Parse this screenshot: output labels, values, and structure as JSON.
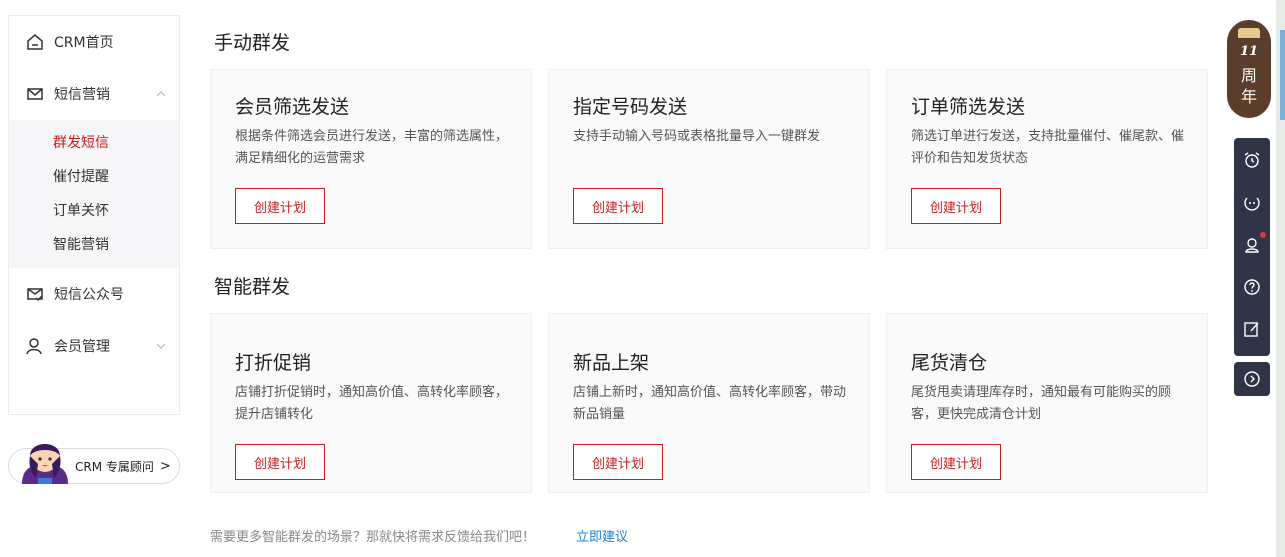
{
  "sidebar": {
    "home": "CRM首页",
    "sms_marketing": "短信营销",
    "sub_items": [
      "群发短信",
      "催付提醒",
      "订单关怀",
      "智能营销"
    ],
    "sms_official": "短信公众号",
    "member_mgmt": "会员管理"
  },
  "advisor": {
    "label": "CRM 专属顾问",
    "arrow": ">"
  },
  "sections": [
    {
      "title": "手动群发",
      "cards": [
        {
          "title": "会员筛选发送",
          "desc": "根据条件筛选会员进行发送，丰富的筛选属性，满足精细化的运营需求",
          "button": "创建计划"
        },
        {
          "title": "指定号码发送",
          "desc": "支持手动输入号码或表格批量导入一键群发",
          "button": "创建计划"
        },
        {
          "title": "订单筛选发送",
          "desc": "筛选订单进行发送，支持批量催付、催尾款、催评价和告知发货状态",
          "button": "创建计划"
        }
      ]
    },
    {
      "title": "智能群发",
      "cards": [
        {
          "title": "打折促销",
          "desc": "店铺打折促销时，通知高价值、高转化率顾客，提升店铺转化",
          "button": "创建计划"
        },
        {
          "title": "新品上架",
          "desc": "店铺上新时，通知高价值、高转化率顾客，带动新品销量",
          "button": "创建计划"
        },
        {
          "title": "尾货清仓",
          "desc": "尾货甩卖请理库存时，通知最有可能购买的顾客，更快完成清仓计划",
          "button": "创建计划"
        }
      ]
    }
  ],
  "footer": {
    "text": "需要更多智能群发的场景？那就快将需求反馈给我们吧！",
    "link": "立即建议"
  },
  "anniversary": {
    "number": "11",
    "char1": "周",
    "char2": "年"
  },
  "toolbar_icons": [
    "alarm-icon",
    "face-icon",
    "support-icon",
    "help-icon",
    "edit-icon",
    "expand-icon"
  ],
  "colors": {
    "accent": "#c81e1e",
    "link": "#1e7fd8",
    "toolbar": "#2f3447"
  }
}
